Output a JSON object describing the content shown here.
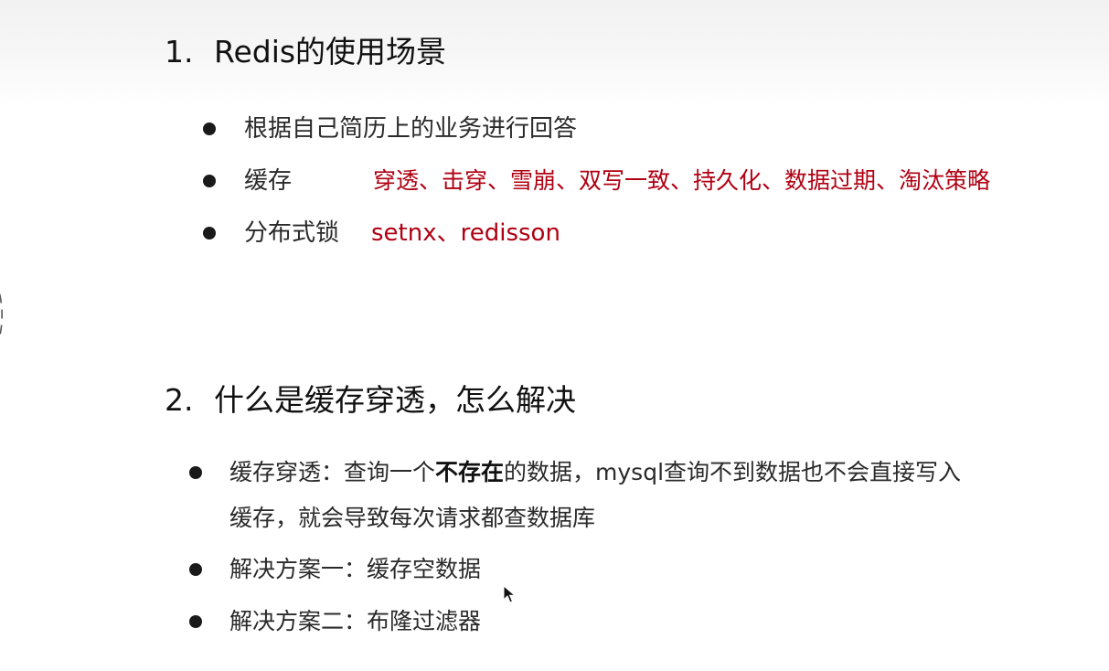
{
  "section1": {
    "number": "1.",
    "title": "Redis的使用场景",
    "items": [
      {
        "label": "根据自己简历上的业务进行回答",
        "detail": ""
      },
      {
        "label": "缓存",
        "detail": "穿透、击穿、雪崩、双写一致、持久化、数据过期、淘汰策略"
      },
      {
        "label": "分布式锁",
        "detail": "setnx、redisson"
      }
    ]
  },
  "section2": {
    "number": "2.",
    "title": "什么是缓存穿透，怎么解决",
    "item1": {
      "prefix": "缓存穿透：查询一个",
      "bold": "不存在",
      "suffix": "的数据，mysql查询不到数据也不会直接写入",
      "line2": "缓存，就会导致每次请求都查数据库"
    },
    "item2": "解决方案一：缓存空数据",
    "item3": "解决方案二：布隆过滤器"
  },
  "colors": {
    "accent_red": "#b00012",
    "text": "#2a2a2a"
  },
  "icons": [
    "mouse-cursor-icon"
  ]
}
